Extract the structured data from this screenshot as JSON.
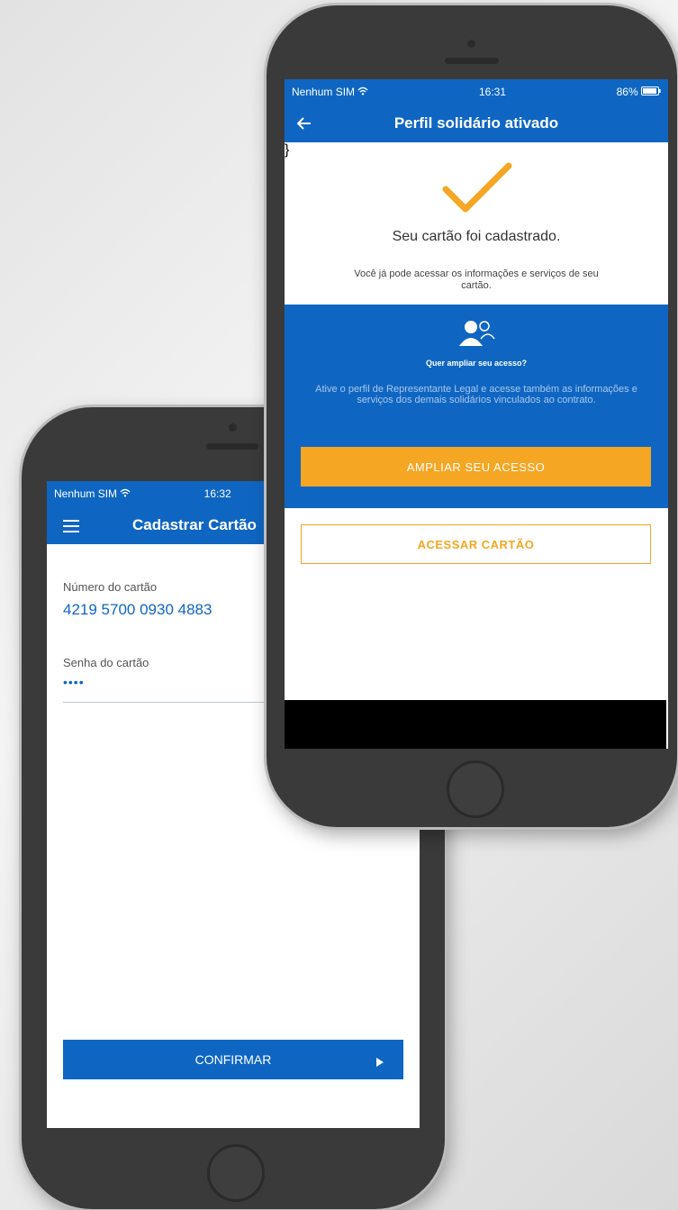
{
  "back_phone": {
    "status": {
      "carrier": "Nenhum SIM",
      "time": "16:32"
    },
    "header": {
      "title": "Cadastrar Cartão"
    },
    "form": {
      "card_number_label": "Número do cartão",
      "card_number_value": "4219 5700 0930 4883",
      "password_label": "Senha do cartão",
      "password_value": "••••"
    },
    "confirm_label": "CONFIRMAR"
  },
  "front_phone": {
    "status": {
      "carrier": "Nenhum SIM",
      "time": "16:31",
      "battery": "86%"
    },
    "header": {
      "title": "Perfil solidário ativado"
    },
    "success": {
      "title": "Seu cartão foi cadastrado.",
      "message": "Você já pode acessar os informações e serviços de seu cartão."
    },
    "promo": {
      "title": "Quer ampliar seu acesso?",
      "text": "Ative o perfil de Representante Legal e acesse também as informações e serviços dos demais solidários vinculados ao contrato.",
      "button_label": "AMPLIAR SEU ACESSO"
    },
    "access_card_label": "ACESSAR CARTÃO"
  },
  "colors": {
    "brand_blue": "#0f66c2",
    "accent_orange": "#f5a623",
    "phone_body": "#3a3a3a"
  },
  "icons": [
    "menu-icon",
    "back-arrow-icon",
    "wifi-icon",
    "battery-icon",
    "checkmark-icon",
    "users-icon",
    "play-icon"
  ]
}
